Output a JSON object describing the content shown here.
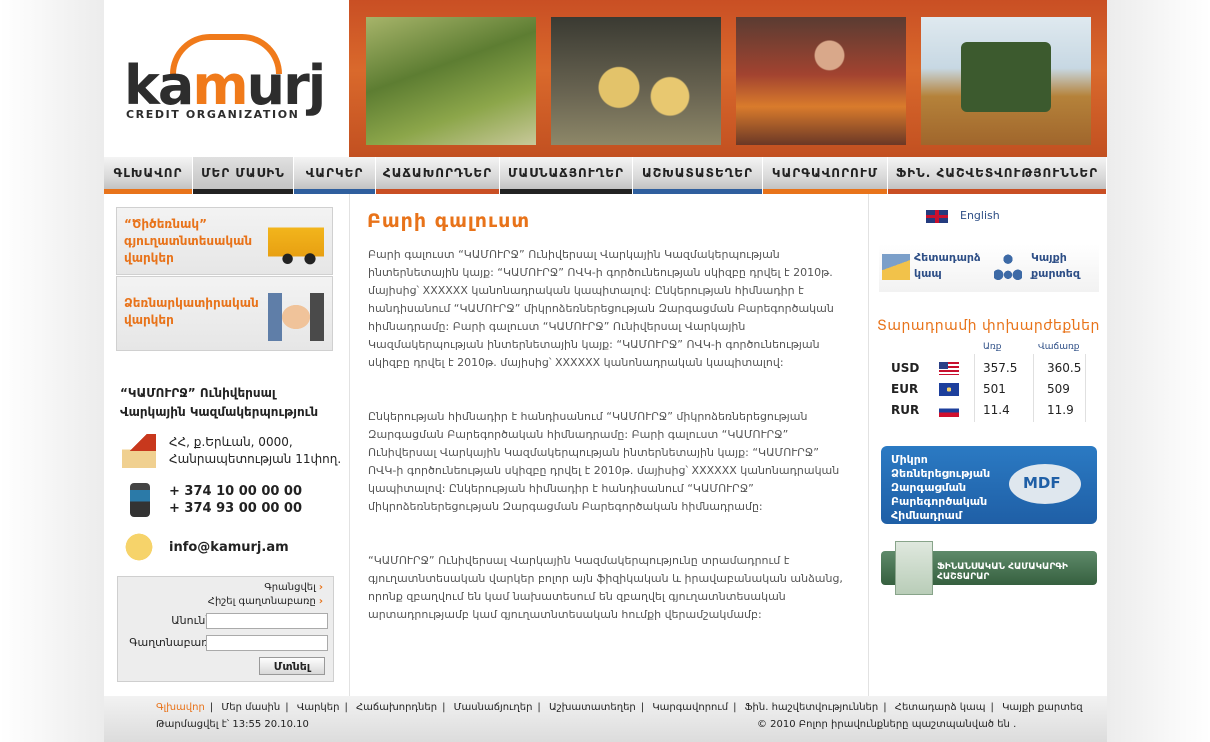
{
  "brand": {
    "word_a": "ka",
    "word_m": "m",
    "word_b": "urj",
    "subtitle": "CREDIT ORGANIZATION"
  },
  "nav": [
    {
      "label": "ԳԼԽԱՎՈՐ",
      "color": "#e8731a"
    },
    {
      "label": "ՄԵՐ ՄԱՍԻՆ",
      "color": "#222222"
    },
    {
      "label": "ՎԱՐԿԵՐ",
      "color": "#2f5f9e"
    },
    {
      "label": "ՀԱՃԱԽՈՐԴՆԵՐ",
      "color": "#c94f24"
    },
    {
      "label": "ՄԱՍՆԱՃՅՈՒՂԵՐ",
      "color": "#222222"
    },
    {
      "label": "ԱՇԽԱՏԱՏԵՂԵՐ",
      "color": "#2f5f9e"
    },
    {
      "label": "ԿԱՐԳԱՎՈՐՈՒՄ",
      "color": "#e8731a"
    },
    {
      "label": "ՖԻՆ. ՀԱՇՎԵՏՎՈՒԹՅՈՒՆՆԵՐ",
      "color": "#c94f24"
    }
  ],
  "promos": [
    {
      "label": "“Ծիծեռնակ” գյուղատնտեսական վարկեր",
      "icon": "loader-icon"
    },
    {
      "label": "Ձեռնարկատիրական վարկեր",
      "icon": "handshake-icon"
    }
  ],
  "contact": {
    "org_name": "“ԿԱՄՈՒՐՋ” Ունիվերսալ Վարկային Կազմակերպություն",
    "address_1": "ՀՀ, ք.Երևան, 0000,",
    "address_2": "Հանրապետության 11փող.",
    "phone_1": "+ 374 10 00 00 00",
    "phone_2": "+ 374 93 00 00 00",
    "email": "info@kamurj.am"
  },
  "login": {
    "register": "Գրանցվել",
    "remember": "Հիշել գաղտնաբառը",
    "name_label": "Անուն՝",
    "password_label": "Գաղտնաբառ՝",
    "name_value": "",
    "password_value": "",
    "submit": "Մտնել"
  },
  "main": {
    "title": "Բարի գալուստ",
    "paragraphs": [
      "Բարի գալուստ “ԿԱՄՈՒՐՋ” Ունիվերսալ Վարկային Կազմակերպության ինտերնետային կայք: “ԿԱՄՈՒՐՋ” ՈՎԿ-ի գործունեության սկիզբը դրվել է 2010թ. մայիսից՝ XXXXXX կանոնադրական կապիտալով: Ընկերության հիմնադիր է հանդիսանում “ԿԱՄՈՒՐՋ” միկրոձեռներեցության Զարգացման Բարեգործական հիմնադրամը: Բարի գալուստ “ԿԱՄՈՒՐՋ” Ունիվերսալ Վարկային Կազմակերպության ինտերնետային կայք: “ԿԱՄՈՒՐՋ” ՈՎԿ-ի գործունեության սկիզբը դրվել է 2010թ. մայիսից՝ XXXXXX կանոնադրական կապիտալով:",
      "Ընկերության հիմնադիր է հանդիսանում “ԿԱՄՈՒՐՋ” միկրոձեռներեցության Զարգացման Բարեգործական հիմնադրամը: Բարի գալուստ “ԿԱՄՈՒՐՋ” Ունիվերսալ Վարկային Կազմակերպության ինտերնետային կայք: “ԿԱՄՈՒՐՋ” ՈՎԿ-ի գործունեության սկիզբը դրվել է 2010թ. մայիսից՝ XXXXXX կանոնադրական կապիտալով: Ընկերության հիմնադիր է հանդիսանում “ԿԱՄՈՒՐՋ” միկրոձեռներեցության Զարգացման Բարեգործական հիմնադրամը:",
      "“ԿԱՄՈՒՐՋ” Ունիվերսալ Վարկային Կազմակերպությունը տրամադրում է գյուղատնտեսական վարկեր բոլոր այն ֆիզիկական և իրավաբանական անձանց, որոնք զբաղվում են կամ նախատեսում են զբաղվել գյուղատնտեսական արտադրությամբ կամ գյուղատնտեսական հումքի վերամշակմամբ:"
    ]
  },
  "right": {
    "lang_label": "English",
    "feedback": "Հետադարձ կապ",
    "sitemap": "Կայքի քարտեզ",
    "rates_title": "Տարադրամի փոխարժեքներ",
    "buy_header": "Առք",
    "sell_header": "Վաճառք",
    "rates": [
      {
        "code": "USD",
        "buy": "357.5",
        "sell": "360.5",
        "flag": "us-flag"
      },
      {
        "code": "EUR",
        "buy": "501",
        "sell": "509",
        "flag": "eu-flag"
      },
      {
        "code": "RUR",
        "buy": "11.4",
        "sell": "11.9",
        "flag": "ru-flag"
      }
    ],
    "mdf_text": "Միկրո Ձեռներեցության Զարգացման Բարեգործական Հիմնադրամ",
    "mdf_logo": "MDF",
    "fin_system_text": "ՖԻՆԱՆՍԱԿԱՆ ՀԱՄԱԿԱՐԳԻ ՀԱՇՏԱՐԱՐ"
  },
  "footer": {
    "links": [
      "Գլխավոր",
      "Մեր մասին",
      "Վարկեր",
      "Հաճախորդներ",
      "Մասնաճյուղեր",
      "Աշխատատեղեր",
      "Կարգավորում",
      "Ֆին. հաշվետվություններ",
      "Հետադարձ կապ",
      "Կայքի քարտեզ"
    ],
    "updated": "Թարմացվել է՝ 13:55  20.10.10",
    "copyright": "© 2010 Բոլոր իրավունքները պաշտպանված են ."
  },
  "colors": {
    "accent": "#e8731a",
    "link_blue": "#2d4e86",
    "header_band": "#c94f24"
  }
}
